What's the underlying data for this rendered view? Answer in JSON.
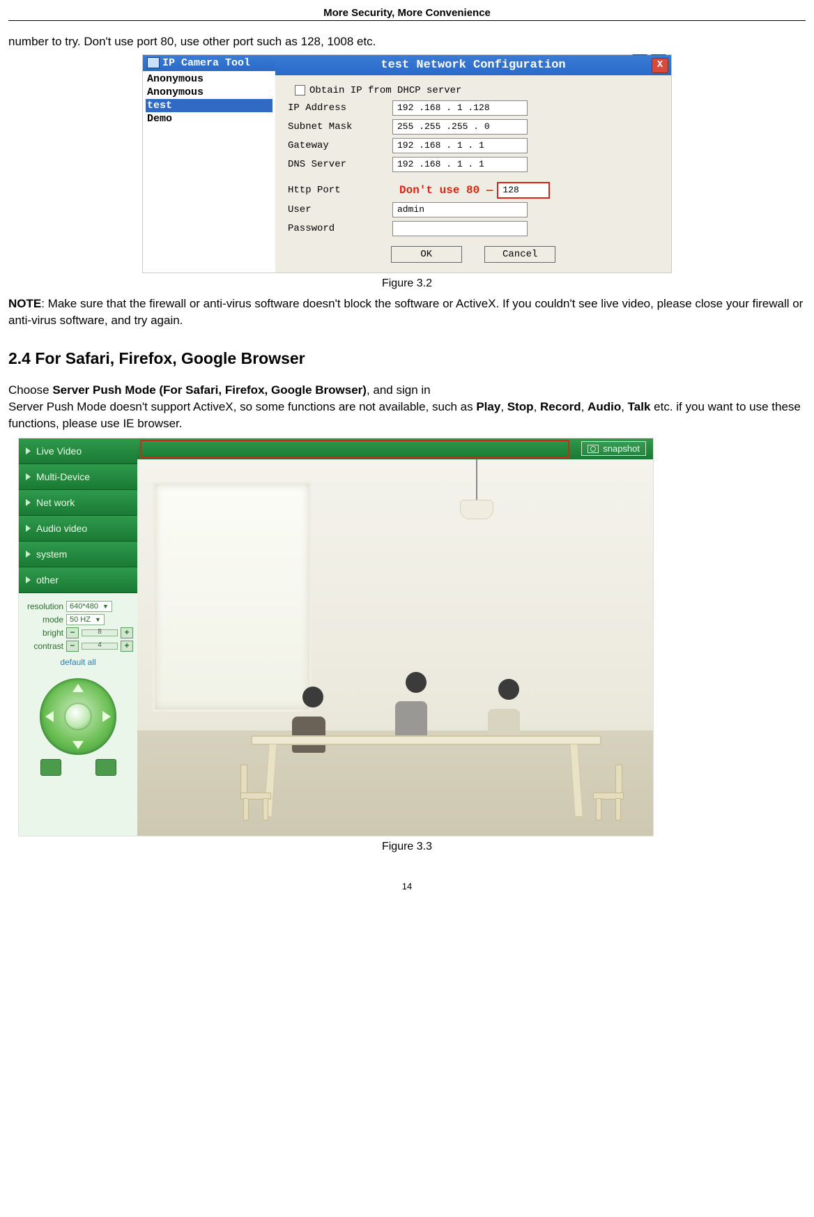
{
  "header": "More Security, More Convenience",
  "intro_line": "number to try. Don't use port 80, use other port such as 128, 1008 etc.",
  "fig32": {
    "left_title": "IP Camera Tool",
    "cameras": [
      "Anonymous",
      "Anonymous",
      "test",
      "Demo"
    ],
    "selected_index": 2,
    "dialog_title": "test Network Configuration",
    "dhcp_label": "Obtain IP from DHCP server",
    "rows": {
      "ip_label": "IP Address",
      "ip_val": "192 .168 . 1   .128",
      "mask_label": "Subnet Mask",
      "mask_val": "255 .255 .255 . 0",
      "gw_label": "Gateway",
      "gw_val": "192 .168 . 1  . 1",
      "dns_label": "DNS Server",
      "dns_val": "192 .168 . 1  . 1",
      "port_label": "Http Port",
      "port_val": "128",
      "port_note": "Don't use 80",
      "user_label": "User",
      "user_val": "admin",
      "pass_label": "Password",
      "pass_val": ""
    },
    "ok": "OK",
    "cancel": "Cancel",
    "caption": "Figure 3.2"
  },
  "note": {
    "label": "NOTE",
    "text": ": Make sure that the firewall or anti-virus software doesn't block the software or ActiveX. If you couldn't see live video, please close your firewall or anti-virus software, and try again."
  },
  "section_heading": "2.4 For Safari, Firefox, Google Browser",
  "para2": {
    "l1a": "Choose ",
    "l1b": "Server Push Mode (For Safari, Firefox, Google Browser)",
    "l1c": ", and sign in",
    "l2a": "Server Push Mode doesn't support ActiveX, so some functions are not available, such as ",
    "play": "Play",
    "c1": ", ",
    "stop": "Stop",
    "c2": ", ",
    "record": "Record",
    "c3": ", ",
    "audio": "Audio",
    "c4": ", ",
    "talk": "Talk",
    "l2b": " etc. if you want to use these functions, please use IE browser."
  },
  "fig33": {
    "nav": [
      "Live Video",
      "Multi-Device",
      "Net work",
      "Audio video",
      "system",
      "other"
    ],
    "controls": {
      "res_label": "resolution",
      "res_val": "640*480",
      "mode_label": "mode",
      "mode_val": "50 HZ",
      "bright_label": "bright",
      "bright_val": "8",
      "contrast_label": "contrast",
      "contrast_val": "4",
      "default": "default all"
    },
    "snapshot": "snapshot",
    "caption": "Figure 3.3"
  },
  "page_number": "14"
}
